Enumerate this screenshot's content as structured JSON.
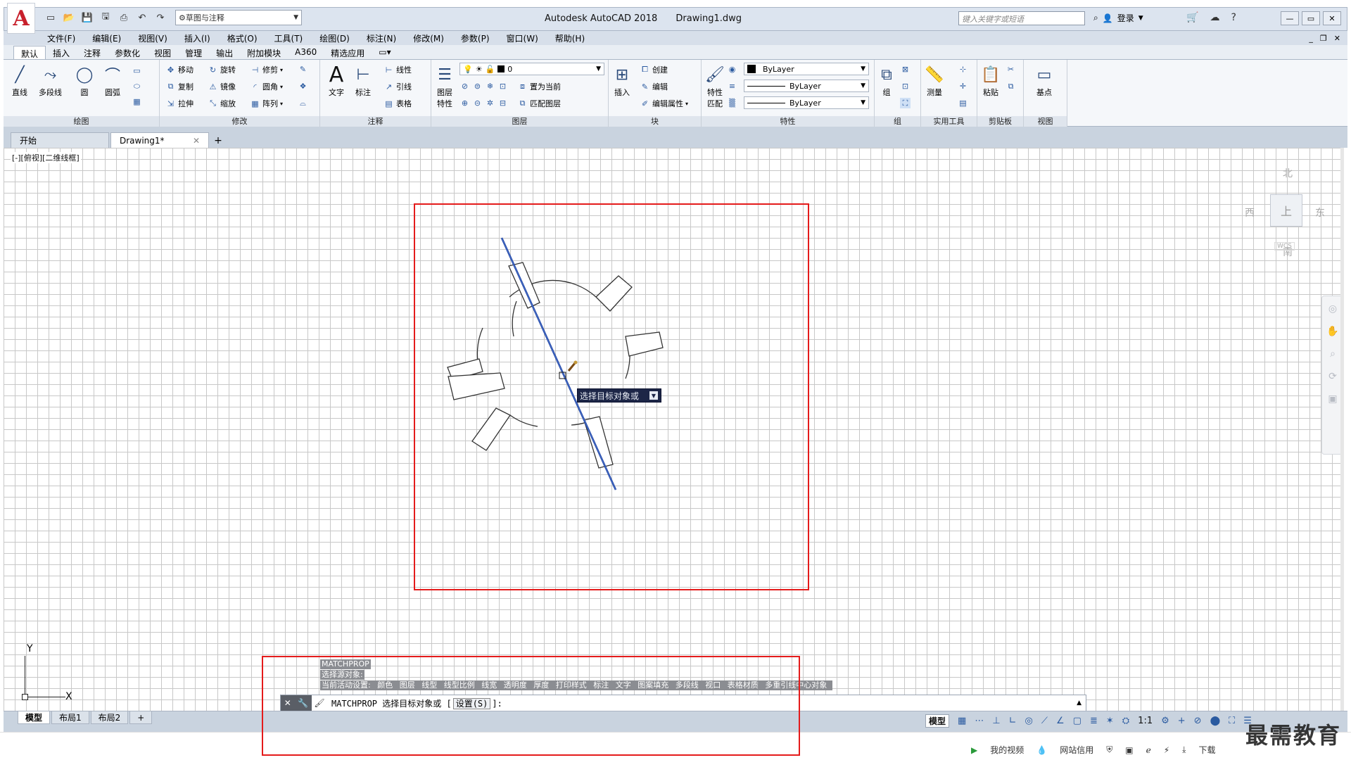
{
  "titlebar": {
    "app_name": "Autodesk AutoCAD 2018",
    "file_name": "Drawing1.dwg",
    "workspace": "草图与注释",
    "search_placeholder": "键入关键字或短语",
    "login_label": "登录"
  },
  "menu": [
    "文件(F)",
    "编辑(E)",
    "视图(V)",
    "插入(I)",
    "格式(O)",
    "工具(T)",
    "绘图(D)",
    "标注(N)",
    "修改(M)",
    "参数(P)",
    "窗口(W)",
    "帮助(H)"
  ],
  "ribbon_tabs": [
    "默认",
    "插入",
    "注释",
    "参数化",
    "视图",
    "管理",
    "输出",
    "附加模块",
    "A360",
    "精选应用"
  ],
  "ribbon": {
    "draw": {
      "title": "绘图",
      "line": "直线",
      "polyline": "多段线",
      "circle": "圆",
      "arc": "圆弧"
    },
    "modify": {
      "title": "修改",
      "move": "移动",
      "rotate": "旋转",
      "trim": "修剪",
      "copy": "复制",
      "mirror": "镜像",
      "fillet": "圆角",
      "stretch": "拉伸",
      "scale": "缩放",
      "array": "阵列"
    },
    "annotation": {
      "title": "注释",
      "text": "文字",
      "dimension": "标注",
      "linear": "线性",
      "leader": "引线",
      "table": "表格"
    },
    "layers": {
      "title": "图层",
      "layer_props_line1": "图层",
      "layer_props_line2": "特性",
      "current_layer": "0",
      "set_current": "置为当前",
      "match_layer": "匹配图层"
    },
    "block": {
      "title": "块",
      "insert": "插入",
      "create": "创建",
      "edit": "编辑",
      "edit_attr": "编辑属性"
    },
    "properties": {
      "title": "特性",
      "match_line1": "特性",
      "match_line2": "匹配",
      "color": "ByLayer",
      "linetype": "ByLayer",
      "lineweight": "ByLayer"
    },
    "groups": {
      "title": "组",
      "group": "组"
    },
    "utilities": {
      "title": "实用工具",
      "measure": "测量"
    },
    "clipboard": {
      "title": "剪贴板",
      "paste": "粘贴"
    },
    "view": {
      "title": "视图",
      "base": "基点"
    }
  },
  "file_tabs": [
    {
      "label": "开始"
    },
    {
      "label": "Drawing1*"
    }
  ],
  "viewport_label": "[-][俯视][二维线框]",
  "viewcube": {
    "north": "北",
    "south": "南",
    "east": "东",
    "west": "西",
    "top": "上",
    "wcs": "WCS"
  },
  "ucs": {
    "x": "X",
    "y": "Y"
  },
  "tooltip": {
    "text": "选择目标对象或"
  },
  "command_history": {
    "line1": "MATCHPROP",
    "line2": "选择源对象:",
    "line3_prefix": "当前活动设置:",
    "settings": [
      "颜色",
      "图层",
      "线型",
      "线型比例",
      "线宽",
      "透明度",
      "厚度",
      "打印样式",
      "标注",
      "文字",
      "图案填充",
      "多段线",
      "视口",
      "表格材质",
      "多重引线中心对象"
    ]
  },
  "command_line": {
    "prompt": "MATCHPROP 选择目标对象或 [",
    "option": "设置(S)",
    "suffix": "]:"
  },
  "layout_tabs": [
    "模型",
    "布局1",
    "布局2"
  ],
  "status": {
    "model": "模型",
    "scale": "1:1"
  },
  "taskbar": {
    "my_video": "我的视频",
    "net_credit": "网站信用",
    "download": "下载"
  },
  "watermark": "最需教育",
  "colors": {
    "annotation_red": "#e41b1b",
    "selected_line": "#1a3fa0",
    "tooltip_bg": "#1d2647"
  }
}
